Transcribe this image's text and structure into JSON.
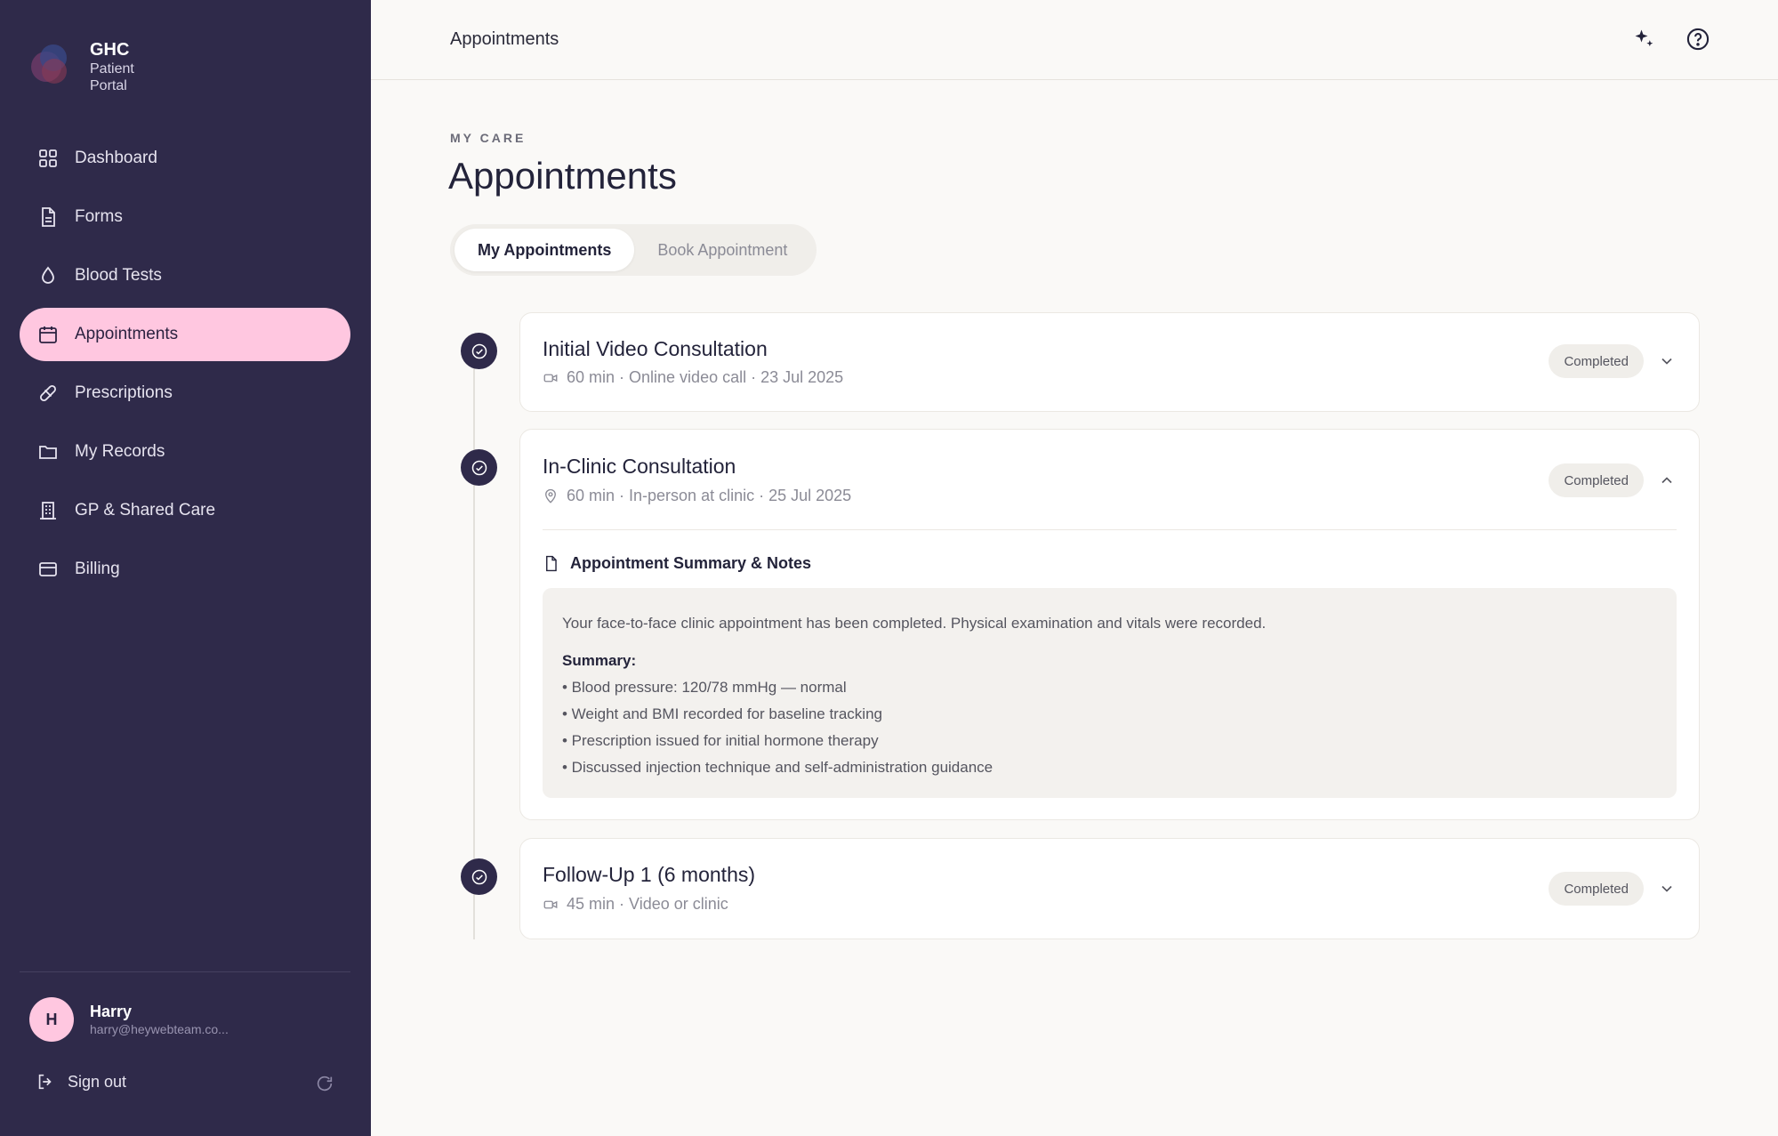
{
  "brand": {
    "name": "GHC",
    "line1": "Patient",
    "line2": "Portal"
  },
  "nav": [
    {
      "label": "Dashboard",
      "icon": "grid-icon"
    },
    {
      "label": "Forms",
      "icon": "document-icon"
    },
    {
      "label": "Blood Tests",
      "icon": "drop-icon"
    },
    {
      "label": "Appointments",
      "icon": "calendar-icon",
      "active": true
    },
    {
      "label": "Prescriptions",
      "icon": "pill-icon"
    },
    {
      "label": "My Records",
      "icon": "folder-icon"
    },
    {
      "label": "GP & Shared Care",
      "icon": "building-icon"
    },
    {
      "label": "Billing",
      "icon": "card-icon"
    }
  ],
  "user": {
    "initial": "H",
    "name": "Harry",
    "email": "harry@heywebteam.co..."
  },
  "signout": "Sign out",
  "topbar": {
    "title": "Appointments"
  },
  "page": {
    "eyebrow": "MY CARE",
    "title": "Appointments"
  },
  "tabs": {
    "my": "My Appointments",
    "book": "Book Appointment"
  },
  "appointments": [
    {
      "title": "Initial Video Consultation",
      "meta": "60 min · Online video call · 23 Jul 2025",
      "status": "Completed",
      "mode_icon": "video-icon"
    },
    {
      "title": "In-Clinic Consultation",
      "meta": "60 min · In-person at clinic · 25 Jul 2025",
      "status": "Completed",
      "mode_icon": "location-pin-icon",
      "notes": {
        "heading": "Appointment Summary & Notes",
        "intro": "Your face-to-face clinic appointment has been completed. Physical examination and vitals were recorded.",
        "summary_label": "Summary:",
        "items": [
          "• Blood pressure: 120/78 mmHg — normal",
          "• Weight and BMI recorded for baseline tracking",
          "• Prescription issued for initial hormone therapy",
          "• Discussed injection technique and self-administration guidance"
        ]
      }
    },
    {
      "title": "Follow-Up 1 (6 months)",
      "meta": "45 min · Video or clinic",
      "status": "Completed",
      "mode_icon": "video-icon"
    }
  ],
  "colors": {
    "sidebar": "#2f2a4a",
    "active_nav": "#ffc7e0",
    "background": "#faf9f7"
  }
}
